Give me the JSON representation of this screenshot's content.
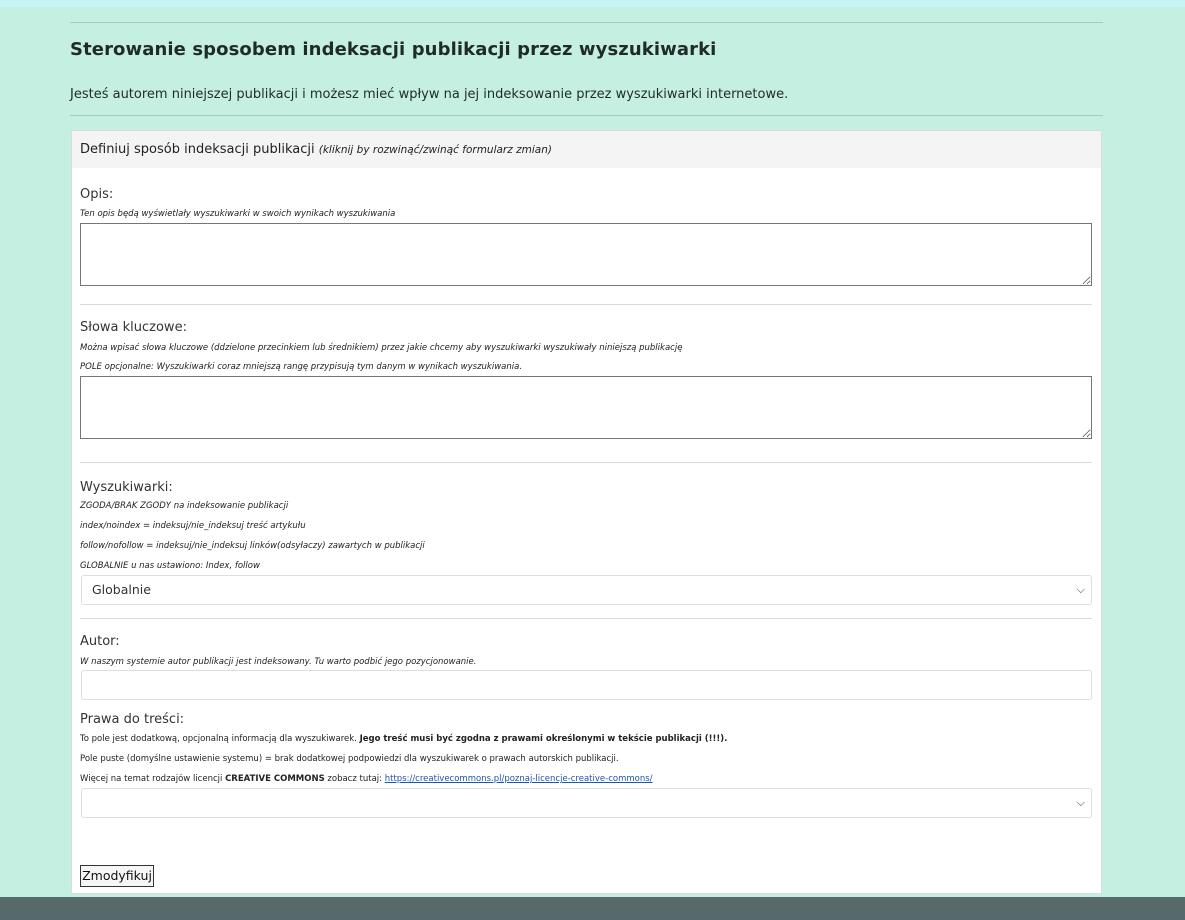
{
  "page": {
    "title": "Sterowanie sposobem indeksacji publikacji przez wyszukiwarki",
    "intro": "Jesteś autorem niniejszej publikacji i możesz mieć wpływ na jej indeksowanie przez wyszukiwarki internetowe."
  },
  "panel": {
    "heading": "Definiuj sposób indeksacji publikacji",
    "hint": "(kliknij by rozwinąć/zwinąć formularz zmian)"
  },
  "opis": {
    "label": "Opis:",
    "help": "Ten opis będą wyświetlały wyszukiwarki w swoich wynikach wyszukiwania",
    "value": ""
  },
  "keywords": {
    "label": "Słowa kluczowe:",
    "help1": "Można wpisać słowa kluczowe (ddzielone przecinkiem lub średnikiem) przez jakie chcemy aby wyszukiwarki wyszukiwały niniejszą publikację",
    "help2": "POLE opcjonalne: Wyszukiwarki coraz mniejszą rangę przypisują tym danym w wynikach wyszukiwania.",
    "value": ""
  },
  "engines": {
    "label": "Wyszukiwarki:",
    "help1": "ZGODA/BRAK ZGODY na indeksowanie publikacji",
    "help2": "index/noindex = indeksuj/nie_indeksuj treść artykułu",
    "help3": "follow/nofollow = indeksuj/nie_indeksuj linków(odsyłaczy) zawartych w publikacji",
    "help4": "GLOBALNIE u nas ustawiono: Index, follow",
    "selected": "Globalnie",
    "chevron_icon": "chevron-down"
  },
  "author": {
    "label": "Autor:",
    "help": "W naszym systemie autor publikacji jest indeksowany. Tu warto podbić jego pozycjonowanie.",
    "value": ""
  },
  "rights": {
    "label": "Prawa do treści:",
    "help1_plain": "To pole jest dodatkową, opcjonalną informacją dla wyszukiwarek. ",
    "help1_bold": "Jego treść musi być zgodna z prawami określonymi w tekście publikacji (!!!).",
    "help2": "Pole puste (domyślne ustawienie systemu) = brak dodatkowej podpowiedzi dla wyszukiwarek o prawach autorskich publikacji.",
    "help3_pre": "Więcej na temat rodzajów licencji ",
    "help3_bold": "CREATIVE COMMONS",
    "help3_mid": " zobacz tutaj: ",
    "link": "https://creativecommons.pl/poznaj-licencje-creative-commons/",
    "selected": "",
    "chevron_icon": "chevron-down"
  },
  "submit": {
    "label": "Zmodyfikuj"
  }
}
